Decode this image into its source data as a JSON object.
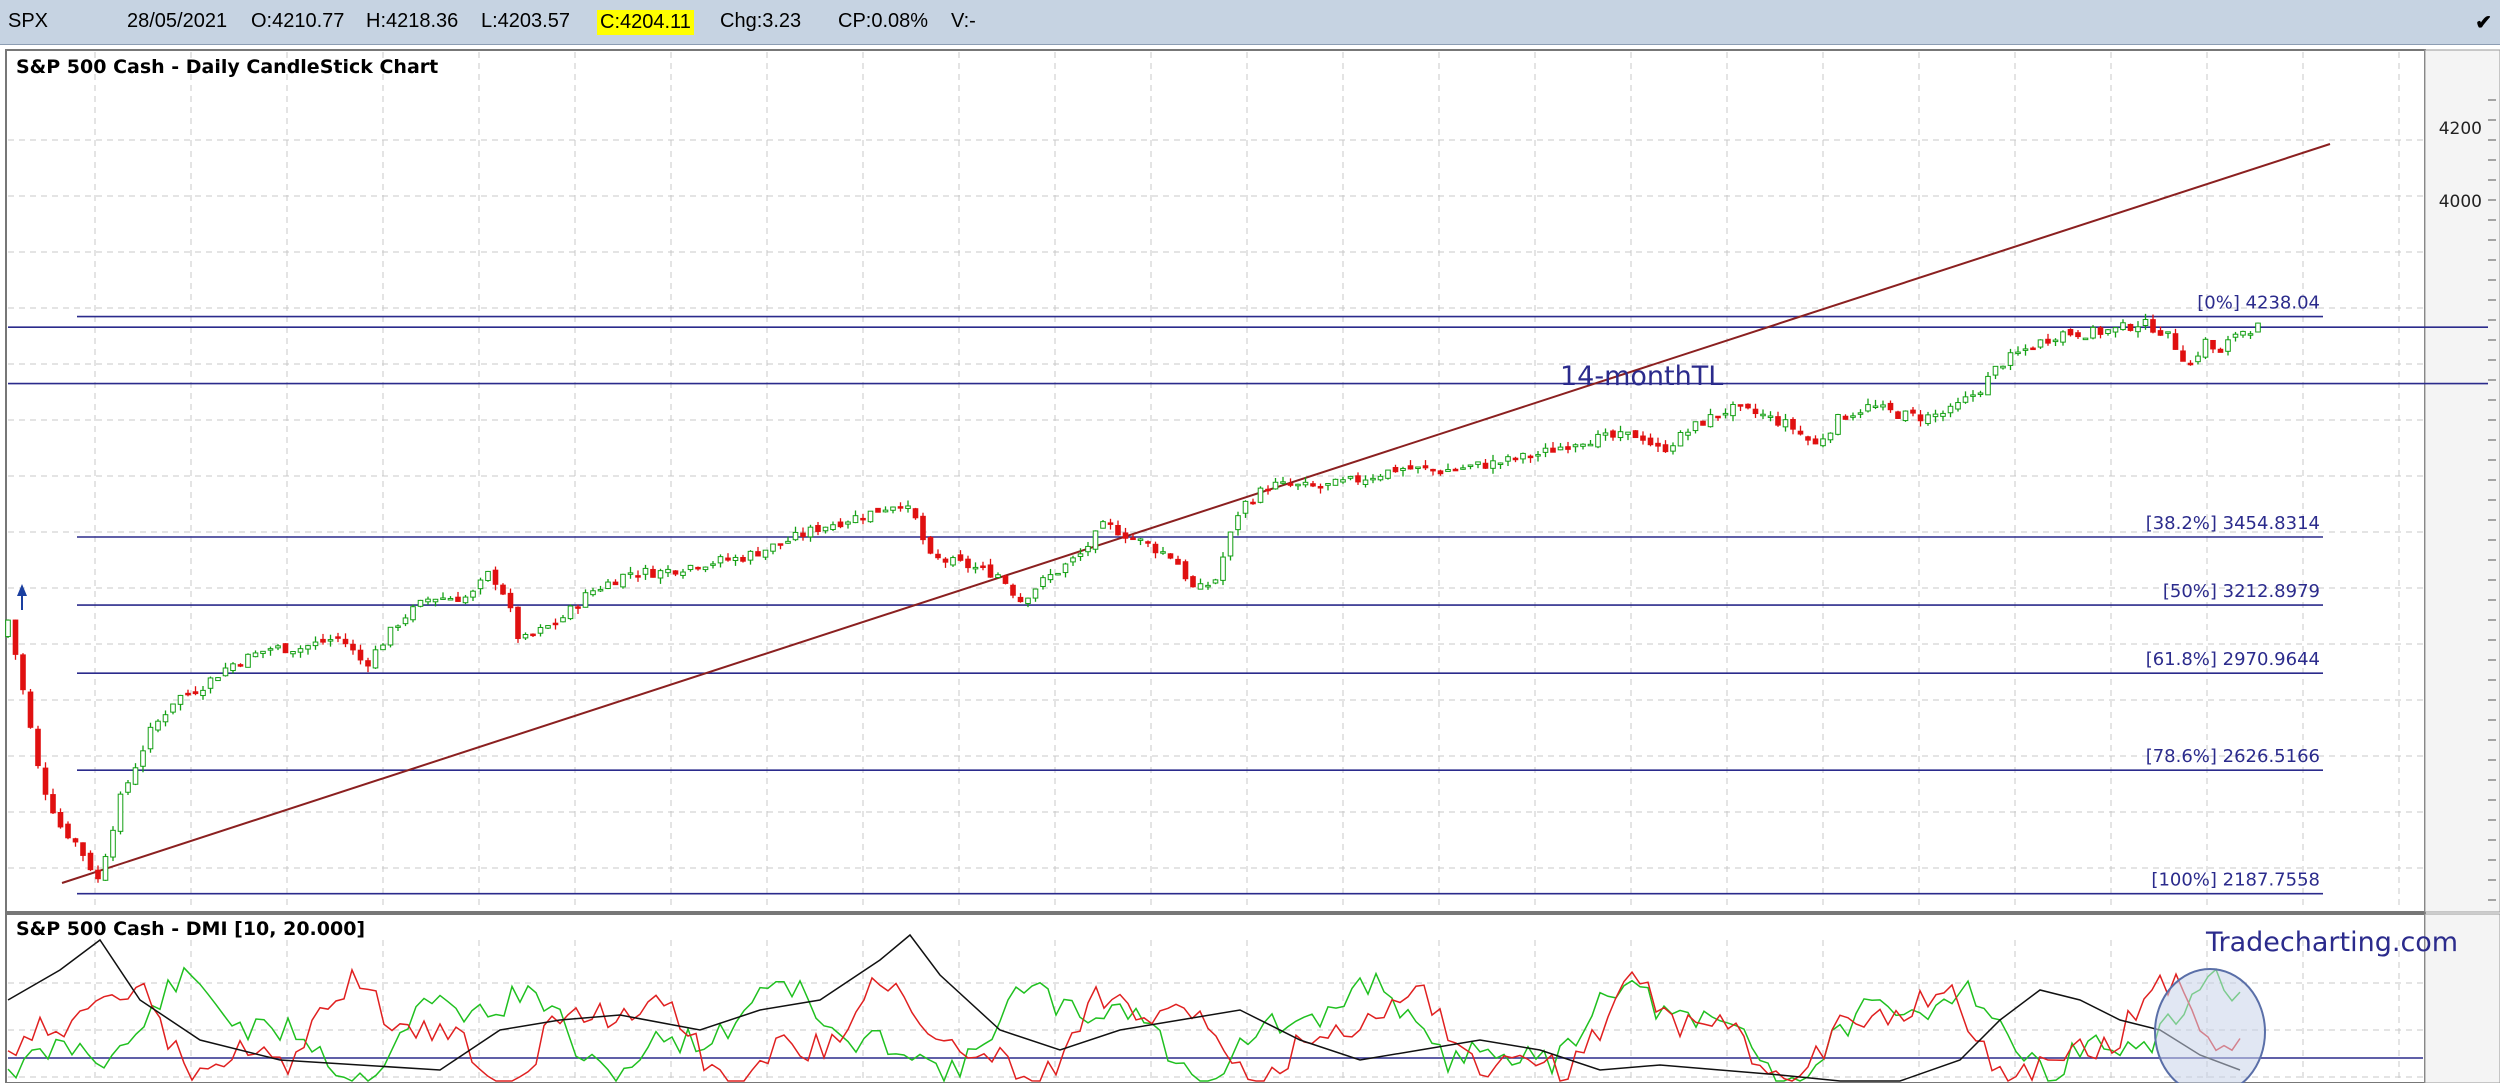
{
  "header": {
    "symbol": "SPX",
    "date": "28/05/2021",
    "open": "O:4210.77",
    "high": "H:4218.36",
    "low": "L:4203.57",
    "close": "C:4204.11",
    "change": "Chg:3.23",
    "change_pct": "CP:0.08%",
    "volume": "V:-",
    "check_mark": "✔"
  },
  "main_panel": {
    "title": "S&P 500 Cash - Daily CandleStick Chart",
    "annotation": "14-monthTL",
    "axis_labels": [
      "4200",
      "4000"
    ],
    "fib_levels": [
      {
        "label": "[0%] 4238.04",
        "value": 4238.04
      },
      {
        "label": "[38.2%] 3454.8314",
        "value": 3454.8314
      },
      {
        "label": "[50%] 3212.8979",
        "value": 3212.8979
      },
      {
        "label": "[61.8%] 2970.9644",
        "value": 2970.9644
      },
      {
        "label": "[78.6%] 2626.5166",
        "value": 2626.5166
      },
      {
        "label": "[100%] 2187.7558",
        "value": 2187.7558
      }
    ],
    "horizontal_levels": [
      4200,
      4000
    ]
  },
  "dmi_panel": {
    "title": "S&P 500 Cash - DMI [10, 20.000]",
    "watermark": "Tradecharting.com"
  },
  "colors": {
    "up": "#14a014",
    "down": "#e01010",
    "level_line": "#2b2b8c",
    "trendline": "#8b2020",
    "plus_di": "#20c020",
    "minus_di": "#e02020",
    "adx": "#111111"
  },
  "chart_data": {
    "type": "candlestick",
    "title": "S&P 500 Cash - Daily CandleStick Chart",
    "symbol": "SPX",
    "last_bar": {
      "date": "28/05/2021",
      "open": 4210.77,
      "high": 4218.36,
      "low": 4203.57,
      "close": 4204.11,
      "change": 3.23,
      "change_pct": 0.08
    },
    "x_range": [
      "2020-03",
      "2021-05-28"
    ],
    "y_range": [
      2150,
      4290
    ],
    "trendline": {
      "name": "14-monthTL",
      "points": [
        [
          "2020-03-23",
          2191
        ],
        [
          "2021-05-28",
          4080
        ]
      ]
    },
    "fib_retracements": [
      {
        "pct": "0%",
        "value": 4238.04
      },
      {
        "pct": "38.2%",
        "value": 3454.8314
      },
      {
        "pct": "50%",
        "value": 3212.8979
      },
      {
        "pct": "61.8%",
        "value": 2970.9644
      },
      {
        "pct": "78.6%",
        "value": 2626.5166
      },
      {
        "pct": "100%",
        "value": 2187.7558
      }
    ],
    "approx_closes": [
      [
        "2020-03",
        3160
      ],
      [
        "2020-03",
        2400
      ],
      [
        "2020-03-23",
        2237
      ],
      [
        "2020-04",
        2750
      ],
      [
        "2020-04",
        2860
      ],
      [
        "2020-05",
        2950
      ],
      [
        "2020-06-08",
        3230
      ],
      [
        "2020-06",
        3050
      ],
      [
        "2020-07",
        3230
      ],
      [
        "2020-08",
        3380
      ],
      [
        "2020-09-02",
        3580
      ],
      [
        "2020-09",
        3280
      ],
      [
        "2020-10-12",
        3530
      ],
      [
        "2020-10-30",
        3270
      ],
      [
        "2020-11",
        3570
      ],
      [
        "2020-12",
        3700
      ],
      [
        "2021-01",
        3800
      ],
      [
        "2021-02",
        3930
      ],
      [
        "2021-03",
        3820
      ],
      [
        "2021-04",
        4180
      ],
      [
        "2021-05-12",
        4063
      ],
      [
        "2021-05-28",
        4204
      ]
    ],
    "indicator": {
      "name": "DMI",
      "params": [
        10,
        20.0
      ],
      "lines": [
        "+DI",
        "-DI",
        "ADX"
      ],
      "threshold": 20
    }
  }
}
